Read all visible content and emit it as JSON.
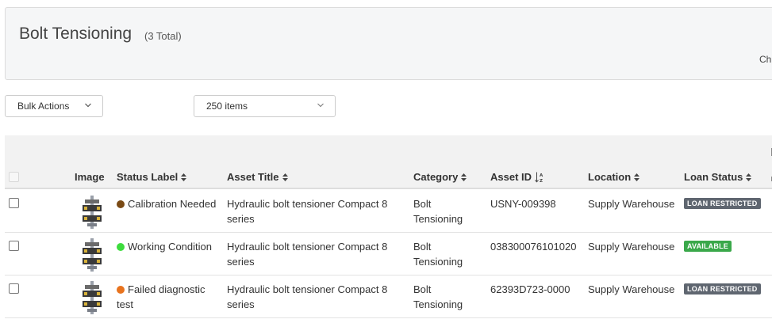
{
  "header": {
    "title": "Bolt Tensioning",
    "count": "(3 Total)",
    "cut_text": "Ch"
  },
  "toolbar": {
    "bulk_label": "Bulk Actions",
    "per_page": "250 items"
  },
  "columns": {
    "image": "Image",
    "status": "Status Label",
    "title": "Asset Title",
    "category": "Category",
    "asset_id": "Asset ID",
    "location": "Location",
    "loan": "Loan Status"
  },
  "colors": {
    "calibration": "#7a4a14",
    "working": "#3ddc3d",
    "failed": "#e8731e",
    "restricted": "#5f6670",
    "available": "#3aa84a"
  },
  "rows": [
    {
      "status": "Calibration Needed",
      "title_line1": "Hydraulic bolt tensioner Compact 8",
      "title_line2": "series",
      "category_line1": "Bolt",
      "category_line2": "Tensioning",
      "asset_id": "USNY-009398",
      "location": "Supply Warehouse",
      "loan": "LOAN RESTRICTED"
    },
    {
      "status": "Working Condition",
      "title_line1": "Hydraulic bolt tensioner Compact 8",
      "title_line2": "series",
      "category_line1": "Bolt",
      "category_line2": "Tensioning",
      "asset_id": "038300076101020",
      "location": "Supply Warehouse",
      "loan": "AVAILABLE"
    },
    {
      "status_line1": "Failed diagnostic",
      "status_line2": "test",
      "title_line1": "Hydraulic bolt tensioner Compact 8",
      "title_line2": "series",
      "category_line1": "Bolt",
      "category_line2": "Tensioning",
      "asset_id": "62393D723-0000",
      "location": "Supply Warehouse",
      "loan": "LOAN RESTRICTED"
    }
  ]
}
